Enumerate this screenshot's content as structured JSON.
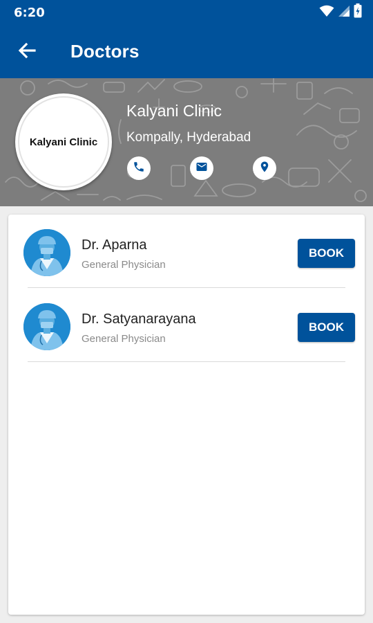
{
  "status_bar": {
    "time": "6:20",
    "icons": [
      "wifi-icon",
      "signal-icon",
      "battery-icon"
    ]
  },
  "app_bar": {
    "title": "Doctors",
    "back_icon": "arrow-back-icon"
  },
  "clinic": {
    "logo_text": "Kalyani Clinic",
    "name": "Kalyani Clinic",
    "location": "Kompally, Hyderabad",
    "actions": [
      "phone-icon",
      "email-icon",
      "location-pin-icon"
    ]
  },
  "doctors": [
    {
      "name": "Dr. Aparna",
      "specialty": "General Physician",
      "button": "BOOK"
    },
    {
      "name": "Dr. Satyanarayana",
      "specialty": "General Physician",
      "button": "BOOK"
    }
  ],
  "colors": {
    "primary": "#00529b",
    "header_background": "#7d7d7d",
    "avatar": "#1f8ad0",
    "page_background": "#eeeeee"
  }
}
